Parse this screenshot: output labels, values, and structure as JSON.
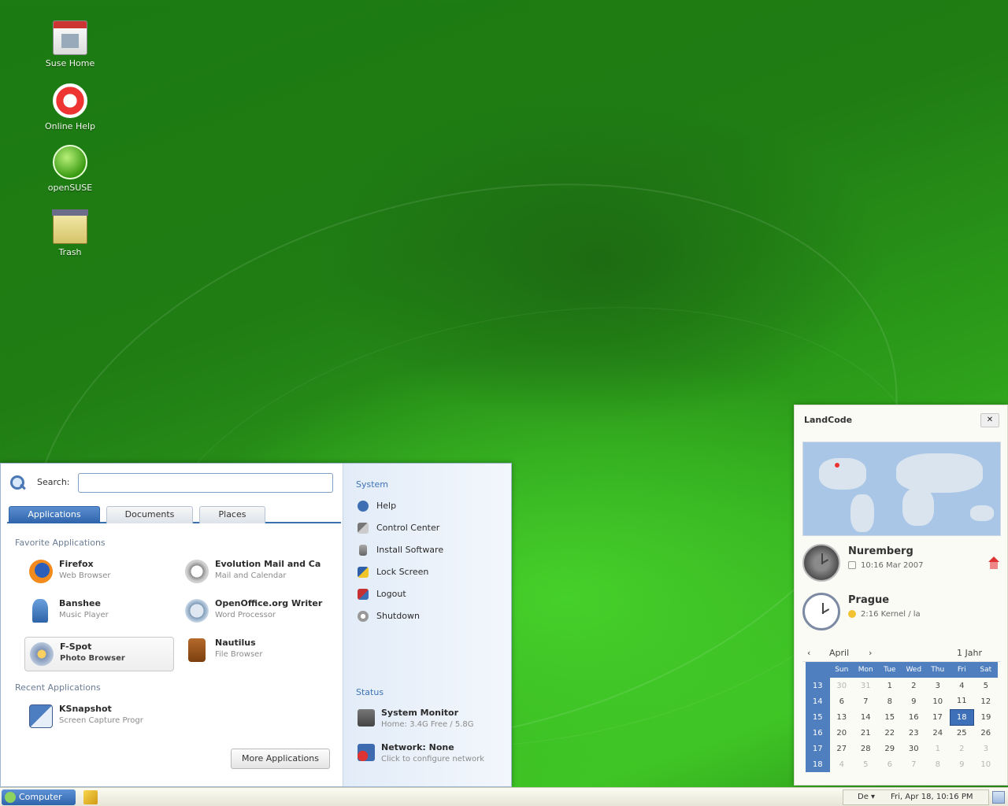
{
  "desktop": {
    "icons": [
      {
        "label": "Suse Home",
        "icon": "home-folder-icon"
      },
      {
        "label": "Online Help",
        "icon": "help-lifebuoy-icon"
      },
      {
        "label": "openSUSE",
        "icon": "opensuse-icon"
      },
      {
        "label": "Trash",
        "icon": "trash-icon"
      }
    ]
  },
  "start_menu": {
    "search_label": "Search:",
    "search_value": "",
    "tabs": [
      "Applications",
      "Documents",
      "Places"
    ],
    "favorites_title": "Favorite Applications",
    "favorites": [
      {
        "name": "Firefox",
        "desc": "Web Browser"
      },
      {
        "name": "Evolution Mail and Ca",
        "desc": "Mail and Calendar"
      },
      {
        "name": "Banshee",
        "desc": "Music Player"
      },
      {
        "name": "OpenOffice.org Writer",
        "desc": "Word Processor"
      },
      {
        "name": "F-Spot",
        "desc": "Photo Browser"
      },
      {
        "name": "Nautilus",
        "desc": "File Browser"
      }
    ],
    "recent_title": "Recent Applications",
    "recent": [
      {
        "name": "KSnapshot",
        "desc": "Screen Capture Progr"
      }
    ],
    "more_button": "More Applications",
    "system_title": "System",
    "system_items": [
      "Help",
      "Control Center",
      "Install Software",
      "Lock Screen",
      "Logout",
      "Shutdown"
    ],
    "status_title": "Status",
    "status_items": [
      {
        "name": "System Monitor",
        "desc": "Home: 3.4G Free / 5.8G"
      },
      {
        "name": "Network: None",
        "desc": "Click to configure network"
      }
    ]
  },
  "widget": {
    "title": "LandCode",
    "close": "✕",
    "clocks": [
      {
        "city": "Nuremberg",
        "time": "10:16 Mar 2007"
      },
      {
        "city": "Prague",
        "time": "2:16 Kernel / la"
      }
    ],
    "calendar": {
      "month": "April",
      "year": "1 Jahr",
      "weekdays": [
        "Sun",
        "Mon",
        "Tue",
        "Wed",
        "Thu",
        "Fri",
        "Sat"
      ],
      "weeks": [
        {
          "wk": "13",
          "days": [
            "30",
            "31",
            "1",
            "2",
            "3",
            "4",
            "5"
          ],
          "dim": [
            true,
            true,
            false,
            false,
            false,
            false,
            false
          ]
        },
        {
          "wk": "14",
          "days": [
            "6",
            "7",
            "8",
            "9",
            "10",
            "11",
            "12"
          ],
          "dim": [
            false,
            false,
            false,
            false,
            false,
            false,
            false
          ]
        },
        {
          "wk": "15",
          "days": [
            "13",
            "14",
            "15",
            "16",
            "17",
            "18",
            "19"
          ],
          "dim": [
            false,
            false,
            false,
            false,
            false,
            false,
            false
          ]
        },
        {
          "wk": "16",
          "days": [
            "20",
            "21",
            "22",
            "23",
            "24",
            "25",
            "26"
          ],
          "dim": [
            false,
            false,
            false,
            false,
            false,
            false,
            false
          ]
        },
        {
          "wk": "17",
          "days": [
            "27",
            "28",
            "29",
            "30",
            "1",
            "2",
            "3"
          ],
          "dim": [
            false,
            false,
            false,
            false,
            true,
            true,
            true
          ]
        },
        {
          "wk": "18",
          "days": [
            "4",
            "5",
            "6",
            "7",
            "8",
            "9",
            "10"
          ],
          "dim": [
            true,
            true,
            true,
            true,
            true,
            true,
            true
          ]
        }
      ],
      "today": "18"
    }
  },
  "taskbar": {
    "start_label": "Computer",
    "tray_items": [
      "De ▾",
      "Fri, Apr 18, 10:16 PM"
    ]
  }
}
